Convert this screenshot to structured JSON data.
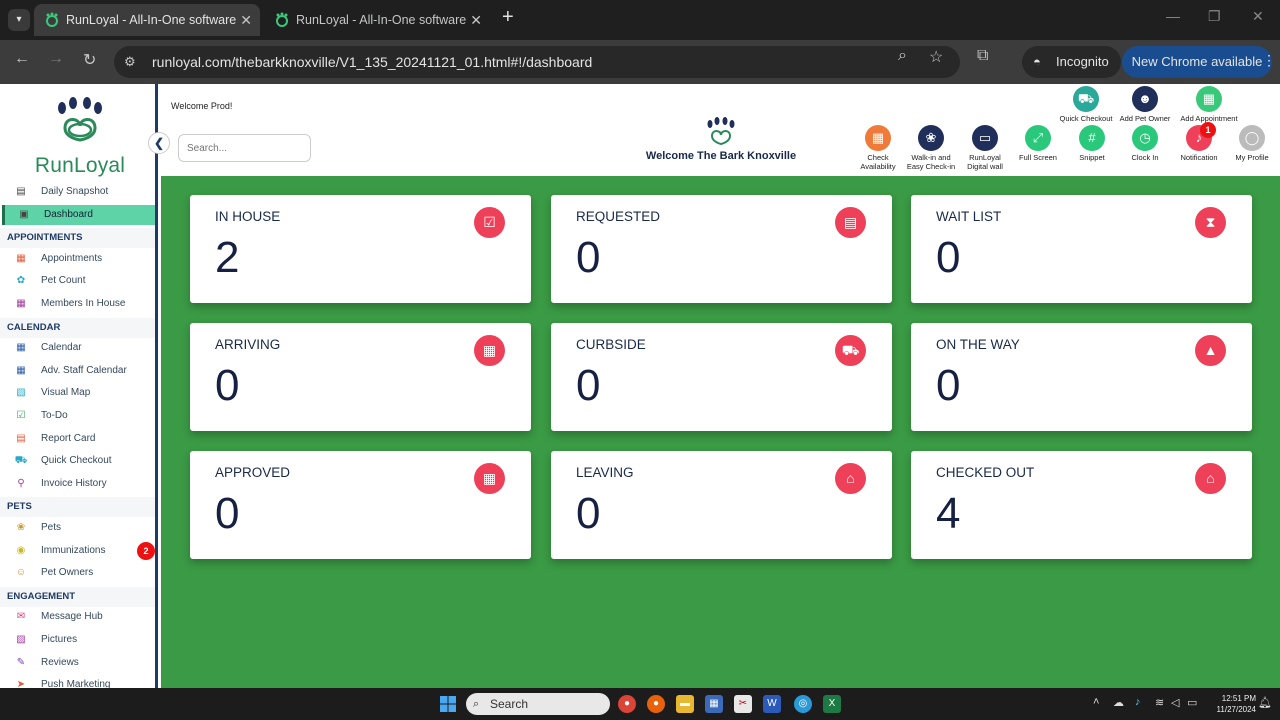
{
  "browser": {
    "tabs": [
      {
        "title": "RunLoyal - All-In-One software",
        "active": true
      },
      {
        "title": "RunLoyal - All-In-One software",
        "active": false
      }
    ],
    "url": "runloyal.com/thebarkknoxville/V1_135_20241121_01.html#!/dashboard",
    "incognito_label": "Incognito",
    "update_label": "New Chrome available"
  },
  "sidebar": {
    "brand": "RunLoyal",
    "items": [
      {
        "label": "Daily Snapshot",
        "icon": "today-icon",
        "color": "#444"
      },
      {
        "label": "Dashboard",
        "icon": "dashboard-icon",
        "color": "#444",
        "active": true
      }
    ],
    "sections": [
      {
        "title": "APPOINTMENTS",
        "items": [
          {
            "label": "Appointments",
            "icon": "appointments-icon",
            "color": "#e05a3a"
          },
          {
            "label": "Pet Count",
            "icon": "pet-count-icon",
            "color": "#2aa8c8"
          },
          {
            "label": "Members In House",
            "icon": "members-icon",
            "color": "#a23a9a"
          }
        ]
      },
      {
        "title": "CALENDAR",
        "items": [
          {
            "label": "Calendar",
            "icon": "calendar-icon",
            "color": "#2b5aa8"
          },
          {
            "label": "Adv. Staff Calendar",
            "icon": "staff-calendar-icon",
            "color": "#2b5aa8"
          },
          {
            "label": "Visual Map",
            "icon": "map-icon",
            "color": "#2aa8c8"
          },
          {
            "label": "To-Do",
            "icon": "todo-icon",
            "color": "#3aa55a"
          },
          {
            "label": "Report Card",
            "icon": "report-card-icon",
            "color": "#e05a3a"
          },
          {
            "label": "Quick Checkout",
            "icon": "cart-icon",
            "color": "#2aa8c8"
          },
          {
            "label": "Invoice History",
            "icon": "invoice-icon",
            "color": "#a23a9a"
          }
        ]
      },
      {
        "title": "PETS",
        "items": [
          {
            "label": "Pets",
            "icon": "paw-icon",
            "color": "#c89a2a"
          },
          {
            "label": "Immunizations",
            "icon": "immunization-icon",
            "color": "#c8b82a",
            "badge": "2"
          },
          {
            "label": "Pet Owners",
            "icon": "person-icon",
            "color": "#e08a2a"
          }
        ]
      },
      {
        "title": "ENGAGEMENT",
        "items": [
          {
            "label": "Message Hub",
            "icon": "message-icon",
            "color": "#e03a7a"
          },
          {
            "label": "Pictures",
            "icon": "pictures-icon",
            "color": "#a23a9a"
          },
          {
            "label": "Reviews",
            "icon": "reviews-icon",
            "color": "#7a3ab8"
          },
          {
            "label": "Push Marketing",
            "icon": "push-icon",
            "color": "#e05a3a"
          }
        ]
      }
    ]
  },
  "header": {
    "welcome_user": "Welcome Prod!",
    "search_placeholder": "Search...",
    "welcome_business": "Welcome The Bark Knoxville",
    "top_buttons": [
      {
        "label": "Quick Checkout",
        "icon": "cart-icon",
        "color": "#2aa89a"
      },
      {
        "label": "Add Pet Owner",
        "icon": "add-person-icon",
        "color": "#1f2f5a"
      },
      {
        "label": "Add Appointment",
        "icon": "add-appointment-icon",
        "color": "#3ac87a"
      }
    ],
    "buttons": [
      {
        "label1": "Check",
        "label2": "Availability",
        "icon": "calendar-icon",
        "color": "#f07a3a"
      },
      {
        "label1": "Walk-in and",
        "label2": "Easy Check-in",
        "icon": "paw-icon",
        "color": "#1f2f5a"
      },
      {
        "label1": "RunLoyal",
        "label2": "Digital wall",
        "icon": "display-icon",
        "color": "#1f2f5a"
      },
      {
        "label1": "Full Screen",
        "label2": "",
        "icon": "fullscreen-icon",
        "color": "#2ac87a"
      },
      {
        "label1": "Snippet",
        "label2": "",
        "icon": "hash-icon",
        "color": "#2ac87a"
      },
      {
        "label1": "Clock In",
        "label2": "",
        "icon": "clock-icon",
        "color": "#2ac87a"
      },
      {
        "label1": "Notification",
        "label2": "",
        "icon": "bell-icon",
        "color": "#ee4058"
      },
      {
        "label1": "My Profile",
        "label2": "",
        "icon": "profile-icon",
        "color": "#bbbbbb"
      }
    ],
    "notification_count": "1"
  },
  "cards": [
    {
      "label": "IN HOUSE",
      "value": "2",
      "icon": "checklist-icon"
    },
    {
      "label": "REQUESTED",
      "value": "0",
      "icon": "request-icon"
    },
    {
      "label": "WAIT LIST",
      "value": "0",
      "icon": "hourglass-icon"
    },
    {
      "label": "ARRIVING",
      "value": "0",
      "icon": "calendar-icon"
    },
    {
      "label": "CURBSIDE",
      "value": "0",
      "icon": "car-icon"
    },
    {
      "label": "ON THE WAY",
      "value": "0",
      "icon": "road-icon"
    },
    {
      "label": "APPROVED",
      "value": "0",
      "icon": "calendar-check-icon"
    },
    {
      "label": "LEAVING",
      "value": "0",
      "icon": "home-icon"
    },
    {
      "label": "CHECKED OUT",
      "value": "4",
      "icon": "home-icon"
    }
  ],
  "taskbar": {
    "search_label": "Search",
    "time": "12:51 PM",
    "date": "11/27/2024"
  }
}
